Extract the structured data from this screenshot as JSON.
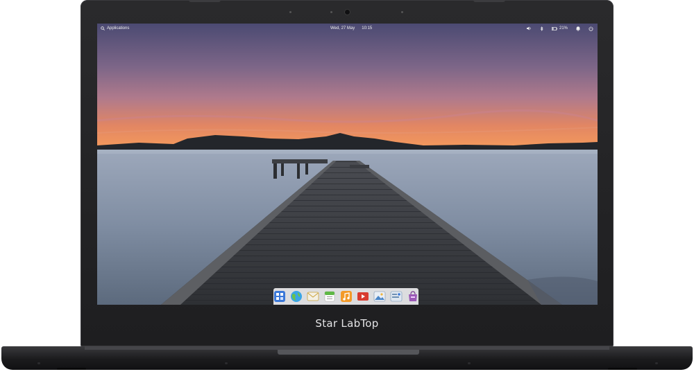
{
  "device": {
    "brand_label": "Star LabTop"
  },
  "panel": {
    "applications_label": "Applications",
    "date": "Wed, 27 May",
    "time": "10:15",
    "battery_percent": "21%",
    "indicators": [
      "volume-icon",
      "bluetooth-icon",
      "battery-icon",
      "notifications-icon",
      "power-icon"
    ]
  },
  "dock": {
    "apps": [
      {
        "name": "multitasking-view-icon",
        "color": "#2f6fd6"
      },
      {
        "name": "web-browser-icon",
        "color": "#3aa5e6"
      },
      {
        "name": "mail-icon",
        "color": "#f0c84a"
      },
      {
        "name": "calendar-icon",
        "color": "#5fb846"
      },
      {
        "name": "music-icon",
        "color": "#f39a28"
      },
      {
        "name": "videos-icon",
        "color": "#d83b2f"
      },
      {
        "name": "photos-icon",
        "color": "#4a86c8"
      },
      {
        "name": "system-settings-icon",
        "color": "#6c8fb3"
      },
      {
        "name": "app-center-icon",
        "color": "#9b59b6"
      }
    ]
  },
  "colors": {
    "sky_top": "#4f4c73",
    "sky_mid": "#9c7592",
    "sky_horizon": "#f0885a",
    "water": "#a9b4c4",
    "bezel": "#242426"
  }
}
